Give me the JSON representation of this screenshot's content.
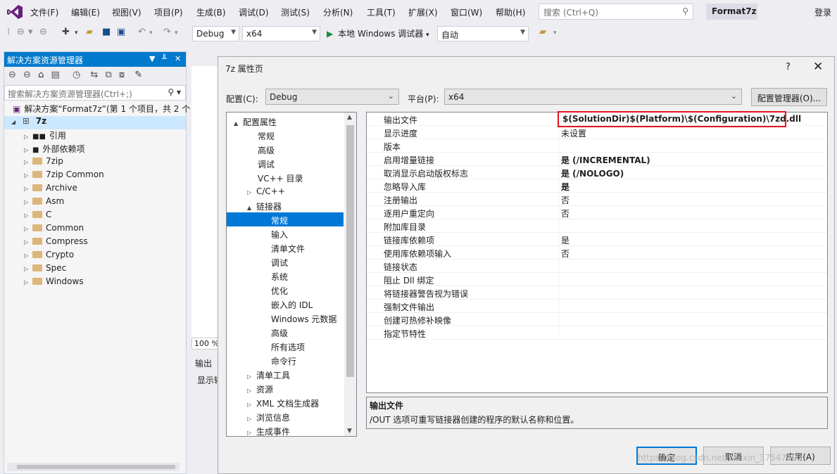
{
  "menubar": {
    "items": [
      "文件(F)",
      "编辑(E)",
      "视图(V)",
      "项目(P)",
      "生成(B)",
      "调试(D)",
      "测试(S)",
      "分析(N)",
      "工具(T)",
      "扩展(X)",
      "窗口(W)",
      "帮助(H)"
    ],
    "search_placeholder": "搜索 (Ctrl+Q)",
    "project_name": "Format7z",
    "login": "登录"
  },
  "toolbar": {
    "config": "Debug",
    "platform": "x64",
    "run_label": "本地 Windows 调试器",
    "mode": "自动"
  },
  "solution_explorer": {
    "title": "解决方案资源管理器",
    "search_placeholder": "搜索解决方案资源管理器(Ctrl+;)",
    "solution_label": "解决方案“Format7z”(第 1 个项目，共 2 个",
    "project": "7z",
    "items": [
      "引用",
      "外部依赖项",
      "7zip",
      "7zip Common",
      "Archive",
      "Asm",
      "C",
      "Common",
      "Compress",
      "Crypto",
      "Spec",
      "Windows"
    ]
  },
  "editor": {
    "zoom": "100 %",
    "output_label": "输出",
    "show_label": "显示输"
  },
  "dialog": {
    "title": "7z 属性页",
    "help": "?",
    "close": "✕",
    "config_label": "配置(C):",
    "config_value": "Debug",
    "platform_label": "平台(P):",
    "platform_value": "x64",
    "config_manager": "配置管理器(O)...",
    "tree": [
      {
        "label": "配置属性",
        "expand": "▲"
      },
      {
        "label": "常规",
        "expand": ""
      },
      {
        "label": "高级",
        "expand": ""
      },
      {
        "label": "调试",
        "expand": ""
      },
      {
        "label": "VC++ 目录",
        "expand": ""
      },
      {
        "label": "C/C++",
        "expand": "▷"
      },
      {
        "label": "链接器",
        "expand": "▲"
      },
      {
        "label": "常规",
        "expand": ""
      },
      {
        "label": "输入",
        "expand": ""
      },
      {
        "label": "清单文件",
        "expand": ""
      },
      {
        "label": "调试",
        "expand": ""
      },
      {
        "label": "系统",
        "expand": ""
      },
      {
        "label": "优化",
        "expand": ""
      },
      {
        "label": "嵌入的 IDL",
        "expand": ""
      },
      {
        "label": "Windows 元数据",
        "expand": ""
      },
      {
        "label": "高级",
        "expand": ""
      },
      {
        "label": "所有选项",
        "expand": ""
      },
      {
        "label": "命令行",
        "expand": ""
      },
      {
        "label": "清单工具",
        "expand": "▷"
      },
      {
        "label": "资源",
        "expand": "▷"
      },
      {
        "label": "XML 文档生成器",
        "expand": "▷"
      },
      {
        "label": "浏览信息",
        "expand": "▷"
      },
      {
        "label": "生成事件",
        "expand": "▷"
      }
    ],
    "selected_tree_item": "常规",
    "properties": [
      {
        "name": "输出文件",
        "value": "$(SolutionDir)$(Platform)\\$(Configuration)\\7zd.dll"
      },
      {
        "name": "显示进度",
        "value": "未设置"
      },
      {
        "name": "版本",
        "value": ""
      },
      {
        "name": "启用增量链接",
        "value": "是 (/INCREMENTAL)"
      },
      {
        "name": "取消显示启动版权标志",
        "value": "是 (/NOLOGO)"
      },
      {
        "name": "忽略导入库",
        "value": "是"
      },
      {
        "name": "注册输出",
        "value": "否"
      },
      {
        "name": "逐用户重定向",
        "value": "否"
      },
      {
        "name": "附加库目录",
        "value": ""
      },
      {
        "name": "链接库依赖项",
        "value": "是"
      },
      {
        "name": "使用库依赖项输入",
        "value": "否"
      },
      {
        "name": "链接状态",
        "value": ""
      },
      {
        "name": "阻止 Dll 绑定",
        "value": ""
      },
      {
        "name": "将链接器警告视为错误",
        "value": ""
      },
      {
        "name": "强制文件输出",
        "value": ""
      },
      {
        "name": "创建可热修补映像",
        "value": ""
      },
      {
        "name": "指定节特性",
        "value": ""
      }
    ],
    "description_title": "输出文件",
    "description_text": "/OUT 选项可重写链接器创建的程序的默认名称和位置。",
    "ok": "确定",
    "cancel": "取消",
    "apply": "应用(A)"
  },
  "watermark": "https://blog.csdn.net/weixin_37547193"
}
